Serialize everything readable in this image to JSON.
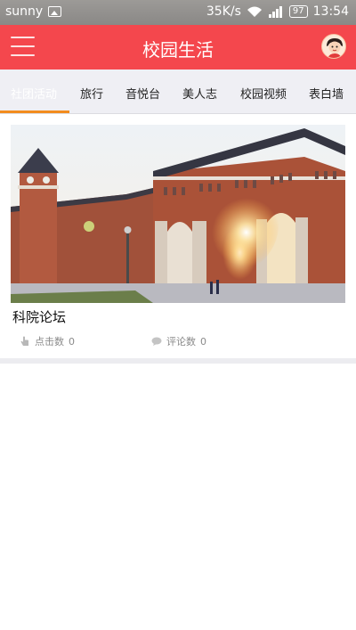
{
  "status_bar": {
    "carrier": "sunny",
    "network_speed": "35K/s",
    "battery": "97",
    "time": "13:54"
  },
  "header": {
    "title": "校园生活"
  },
  "tabs": [
    {
      "label": "社团活动",
      "active": true
    },
    {
      "label": "旅行",
      "active": false
    },
    {
      "label": "音悦台",
      "active": false
    },
    {
      "label": "美人志",
      "active": false
    },
    {
      "label": "校园视频",
      "active": false
    },
    {
      "label": "表白墙",
      "active": false
    }
  ],
  "posts": [
    {
      "title": "科院论坛",
      "clicks_label": "点击数",
      "clicks": "0",
      "comments_label": "评论数",
      "comments": "0"
    }
  ],
  "colors": {
    "header_bg": "#f4474d",
    "tab_indicator": "#f28c1e",
    "tab_bar_bg": "#efeff4"
  },
  "icons": {
    "menu": "hamburger-menu-icon",
    "avatar": "user-avatar",
    "clicks": "hand-pointer-icon",
    "comments": "speech-bubble-icon"
  }
}
